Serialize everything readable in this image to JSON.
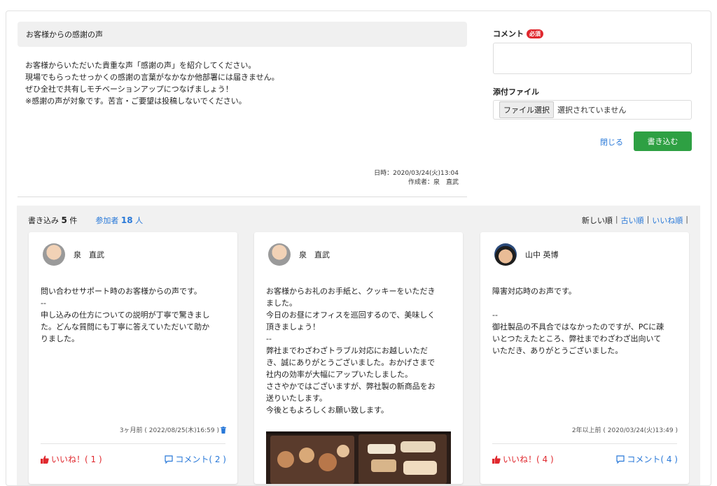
{
  "post": {
    "title": "お客様からの感謝の声",
    "body": [
      "お客様からいただいた貴重な声「感謝の声」を紹介してください。",
      "現場でもらったせっかくの感謝の言葉がなかなか他部署には届きません。",
      "ぜひ全社で共有しモチベーションアップにつなげましょう！",
      "※感謝の声が対象です。苦言・ご要望は投稿しないでください。"
    ],
    "date": "日時：2020/03/24(火)13:04",
    "author": "作成者：泉　直武"
  },
  "form": {
    "comment_label": "コメント",
    "required_badge": "必須",
    "comment_value": "",
    "attach_label": "添付ファイル",
    "file_button": "ファイル選択",
    "file_status": "選択されていません",
    "close_label": "閉じる",
    "submit_label": "書き込む"
  },
  "summary": {
    "posts_label": "書き込み",
    "posts_count": "5",
    "posts_unit": "件",
    "participants_label": "参加者",
    "participants_count": "18",
    "participants_unit": "人"
  },
  "sort": {
    "newest": "新しい順",
    "oldest": "古い順",
    "likes": "いいね順",
    "separator": "|"
  },
  "cards": [
    {
      "author": "泉　直武",
      "lines": [
        "問い合わせサポート時のお客様からの声です。",
        "--",
        "申し込みの仕方についての説明が丁寧で驚きまし",
        "た。どんな質問にも丁寧に答えていただいて助か",
        "りました。"
      ],
      "time": "3ヶ月前 ( 2022/08/25(木)16:59 )",
      "like_label": "いいね！( 1 )",
      "comment_label": "コメント( 2 )"
    },
    {
      "author": "泉　直武",
      "lines": [
        "お客様からお礼のお手紙と、クッキーをいただき",
        "ました。",
        "今日のお昼にオフィスを巡回するので、美味しく",
        "頂きましょう！",
        "--",
        "弊社までわざわざトラブル対応にお越しいただ",
        "き、誠にありがとうございました。おかげさまで",
        "社内の効率が大幅にアップいたしました。",
        "ささやかではございますが、弊社製の新商品をお",
        "送りいたします。",
        "今後ともよろしくお願い致します。"
      ]
    },
    {
      "author": "山中 英博",
      "lines": [
        "障害対応時のお声です。",
        "",
        "--",
        "御社製品の不具合ではなかったのですが、PCに疎",
        "いとつたえたところ、弊社までわざわざ出向いて",
        "いただき、ありがとうございました。"
      ],
      "time": "2年以上前 ( 2020/03/24(火)13:49 )",
      "like_label": "いいね！( 4 )",
      "comment_label": "コメント( 4 )"
    }
  ],
  "colors": {
    "accent_blue": "#2878d8",
    "submit_green": "#2ea043",
    "required_red": "#e0282e"
  }
}
